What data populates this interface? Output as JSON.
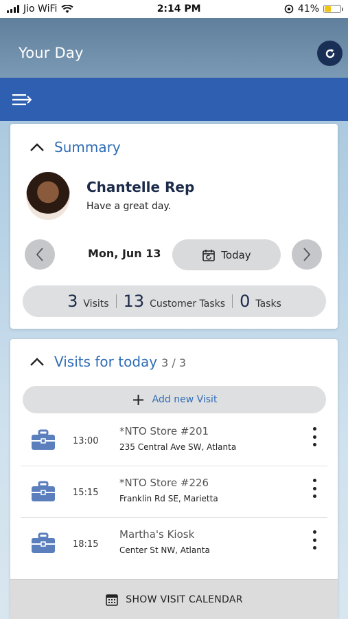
{
  "status": {
    "carrier": "Jio WiFi",
    "time": "2:14 PM",
    "battery": "41%",
    "battery_level": 0.41
  },
  "header": {
    "title": "Your Day"
  },
  "summary": {
    "title": "Summary",
    "user_name": "Chantelle Rep",
    "greeting": "Have a great day.",
    "date": "Mon, Jun 13",
    "today_label": "Today",
    "stats": [
      {
        "value": "3",
        "label": "Visits"
      },
      {
        "value": "13",
        "label": "Customer Tasks"
      },
      {
        "value": "0",
        "label": "Tasks"
      }
    ]
  },
  "visits": {
    "title": "Visits for today",
    "count": "3 / 3",
    "add_label": "Add new Visit",
    "items": [
      {
        "time": "13:00",
        "store": "*NTO Store #201",
        "address": "235 Central Ave SW, Atlanta"
      },
      {
        "time": "15:15",
        "store": "*NTO Store #226",
        "address": "Franklin Rd SE, Marietta"
      },
      {
        "time": "18:15",
        "store": "Martha's Kiosk",
        "address": "Center St NW, Atlanta"
      }
    ],
    "calendar_label": "SHOW VISIT CALENDAR"
  },
  "colors": {
    "nav_blue": "#2e5fb1",
    "title_blue": "#2e6cb5",
    "dark_navy": "#1a2f56",
    "briefcase": "#5b7fbd"
  }
}
